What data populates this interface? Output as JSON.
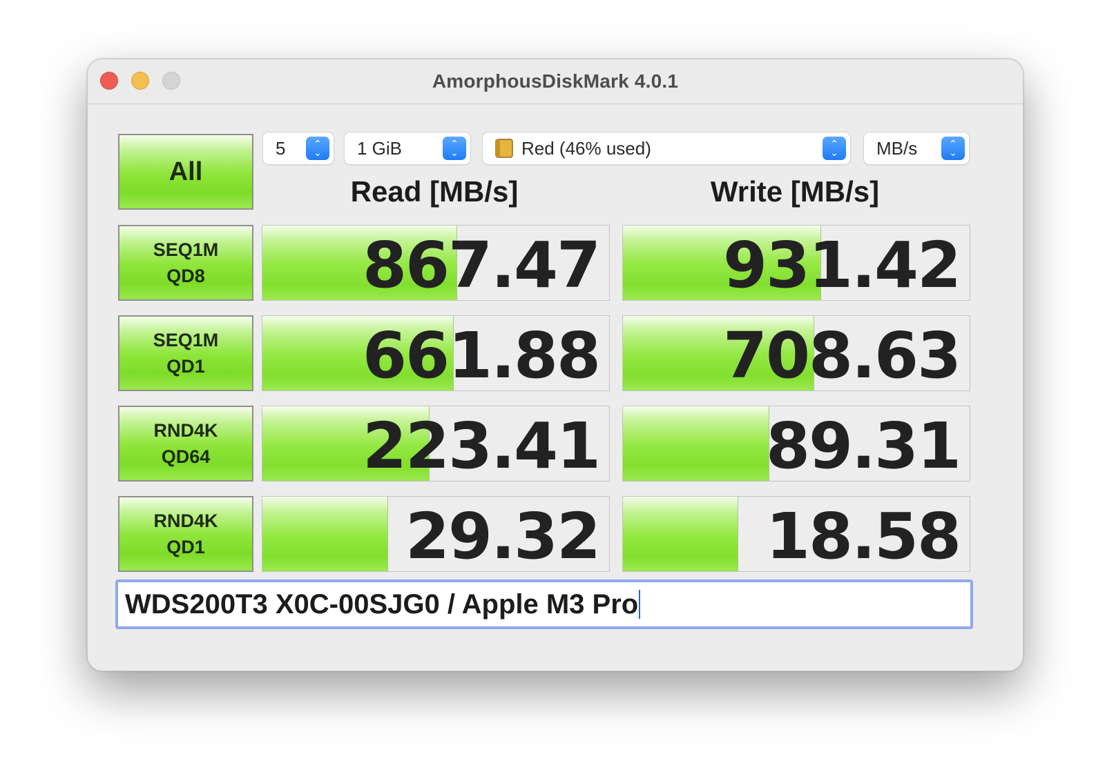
{
  "window": {
    "title": "AmorphousDiskMark 4.0.1"
  },
  "controls": {
    "all_button": "All",
    "count": "5",
    "size": "1 GiB",
    "disk": "Red (46% used)",
    "unit": "MB/s"
  },
  "headers": {
    "read": "Read [MB/s]",
    "write": "Write [MB/s]"
  },
  "tests": [
    {
      "line1": "SEQ1M",
      "line2": "QD8",
      "read": "867.47",
      "write": "931.42",
      "read_level": 0.56,
      "write_level": 0.57
    },
    {
      "line1": "SEQ1M",
      "line2": "QD1",
      "read": "661.88",
      "write": "708.63",
      "read_level": 0.55,
      "write_level": 0.55
    },
    {
      "line1": "RND4K",
      "line2": "QD64",
      "read": "223.41",
      "write": "89.31",
      "read_level": 0.48,
      "write_level": 0.42
    },
    {
      "line1": "RND4K",
      "line2": "QD1",
      "read": "29.32",
      "write": "18.58",
      "read_level": 0.36,
      "write_level": 0.33
    }
  ],
  "comment": "WDS200T3 X0C-00SJG0 / Apple M3 Pro",
  "colors": {
    "bar_green": "#8fe53a",
    "focus_ring": "#90a9ec",
    "stepper_blue": "#1f7cf5"
  }
}
